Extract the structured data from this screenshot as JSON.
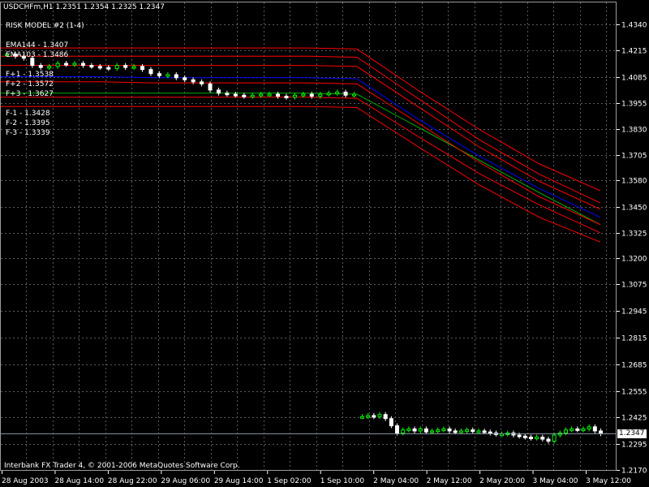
{
  "header": {
    "symbol_line": "USDCHFm,H1  1.2351 1.2354 1.2325 1.2347",
    "model_label": "RISK MODEL #2 (1-4)"
  },
  "indicators": {
    "ema144": "EMA144 - 1.3407",
    "ema103": "EMA103 - 1.3486",
    "f_plus": [
      "F+1 - 1.3538",
      "F+2 - 1.3572",
      "F+3 - 1.3627"
    ],
    "f_minus": [
      "F-1 - 1.3428",
      "F-2 - 1.3395",
      "F-3 - 1.3339"
    ]
  },
  "footer": {
    "copyright": "Interbank FX Trader 4, © 2001-2006 MetaQuotes Software Corp."
  },
  "current_price": "1.2347",
  "colors": {
    "background": "#000000",
    "grid": "#5a5a5a",
    "bands": "#ff0000",
    "ema_blue": "#0000ff",
    "ema_green": "#00aa00",
    "candle": "#ffffff",
    "bull": "#00ff00",
    "price_line": "#7f8c9a"
  },
  "chart_data": {
    "type": "line",
    "title": "USDCHFm,H1",
    "y_axis_ticks": [
      "1.4340",
      "1.4215",
      "1.4085",
      "1.3955",
      "1.3830",
      "1.3705",
      "1.3580",
      "1.3450",
      "1.3325",
      "1.3200",
      "1.3075",
      "1.2945",
      "1.2815",
      "1.2685",
      "1.2555",
      "1.2425",
      "1.2295",
      "1.2170"
    ],
    "ylim": [
      1.217,
      1.434
    ],
    "x_axis_ticks": [
      "28 Aug 2003",
      "28 Aug 14:00",
      "28 Aug 22:00",
      "29 Aug 06:00",
      "29 Aug 14:00",
      "1 Sep 02:00",
      "1 Sep 10:00",
      "2 May 04:00",
      "2 May 12:00",
      "2 May 20:00",
      "3 May 04:00",
      "3 May 12:00"
    ],
    "grid": true,
    "series": [
      {
        "name": "F+3",
        "values": [
          1.4225,
          1.4225,
          1.4225,
          1.4225,
          1.4225,
          1.4225,
          1.4225,
          1.422,
          1.402,
          1.383,
          1.366,
          1.353
        ]
      },
      {
        "name": "F+2",
        "values": [
          1.4185,
          1.4185,
          1.4185,
          1.4185,
          1.4185,
          1.4185,
          1.4185,
          1.418,
          1.398,
          1.378,
          1.361,
          1.347
        ]
      },
      {
        "name": "F+1",
        "values": [
          1.414,
          1.414,
          1.414,
          1.414,
          1.414,
          1.414,
          1.414,
          1.4135,
          1.394,
          1.3745,
          1.3575,
          1.344
        ]
      },
      {
        "name": "EMA144",
        "values": [
          1.4085,
          1.4085,
          1.4085,
          1.408,
          1.408,
          1.408,
          1.408,
          1.4075,
          1.388,
          1.37,
          1.354,
          1.34
        ]
      },
      {
        "name": "EMA103",
        "values": [
          1.4005,
          1.4005,
          1.4005,
          1.4005,
          1.4005,
          1.4005,
          1.4005,
          1.4,
          1.384,
          1.368,
          1.352,
          1.3365
        ]
      },
      {
        "name": "F-1",
        "values": [
          1.406,
          1.406,
          1.406,
          1.4055,
          1.4055,
          1.4055,
          1.4055,
          1.405,
          1.386,
          1.367,
          1.35,
          1.3365
        ]
      },
      {
        "name": "F-2",
        "values": [
          1.3985,
          1.3985,
          1.3985,
          1.3985,
          1.3985,
          1.3985,
          1.3985,
          1.398,
          1.3795,
          1.3615,
          1.346,
          1.3325
        ]
      },
      {
        "name": "F-3",
        "values": [
          1.394,
          1.394,
          1.394,
          1.394,
          1.394,
          1.394,
          1.394,
          1.3935,
          1.3745,
          1.356,
          1.34,
          1.328
        ]
      }
    ],
    "price_upper": [
      1.4195,
      1.4185,
      1.4175,
      1.414,
      1.413,
      1.4135,
      1.415,
      1.4145,
      1.415,
      1.414,
      1.4135,
      1.413,
      1.4125,
      1.414,
      1.413,
      1.4135,
      1.412,
      1.41,
      1.409,
      1.4095,
      1.408,
      1.407,
      1.406,
      1.405,
      1.402,
      1.4005,
      1.4,
      1.3995,
      1.399,
      1.3995,
      1.4,
      1.4,
      1.399,
      1.3985,
      1.3995,
      1.4,
      1.399,
      1.4,
      1.4005,
      1.401,
      1.3995,
      1.4
    ],
    "price_lower": [
      1.243,
      1.2435,
      1.243,
      1.244,
      1.242,
      1.2385,
      1.235,
      1.2365,
      1.237,
      1.236,
      1.237,
      1.2355,
      1.236,
      1.2365,
      1.237,
      1.236,
      1.2355,
      1.236,
      1.2365,
      1.236,
      1.236,
      1.2355,
      1.235,
      1.2345,
      1.2345,
      1.235,
      1.234,
      1.2335,
      1.233,
      1.2325,
      1.233,
      1.232,
      1.231,
      1.234,
      1.235,
      1.2365,
      1.237,
      1.2365,
      1.237,
      1.238,
      1.236,
      1.2347
    ]
  }
}
